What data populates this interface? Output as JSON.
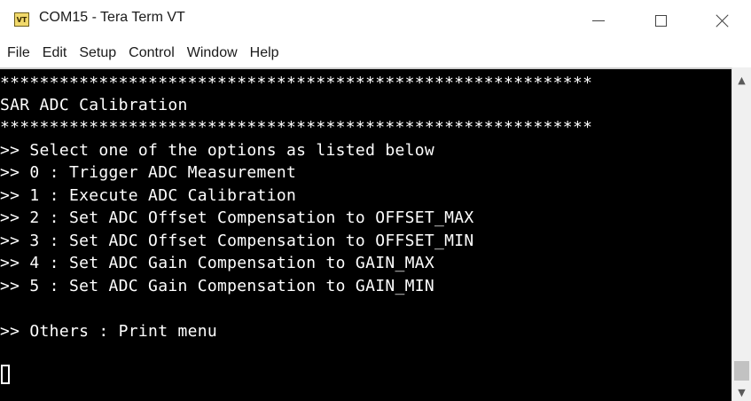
{
  "window": {
    "icon_label": "VT",
    "title": "COM15 - Tera Term VT"
  },
  "menu": [
    "File",
    "Edit",
    "Setup",
    "Control",
    "Window",
    "Help"
  ],
  "terminal": {
    "lines": [
      "************************************************************",
      "SAR ADC Calibration",
      "************************************************************",
      ">> Select one of the options as listed below",
      ">> 0 : Trigger ADC Measurement",
      ">> 1 : Execute ADC Calibration",
      ">> 2 : Set ADC Offset Compensation to OFFSET_MAX",
      ">> 3 : Set ADC Offset Compensation to OFFSET_MIN",
      ">> 4 : Set ADC Gain Compensation to GAIN_MAX",
      ">> 5 : Set ADC Gain Compensation to GAIN_MIN",
      "",
      ">> Others : Print menu"
    ]
  },
  "icons": {
    "minimize": "minimize-icon",
    "maximize": "maximize-icon",
    "close": "close-icon",
    "scroll_up": "scroll-up-arrow-icon",
    "scroll_down": "scroll-down-arrow-icon"
  }
}
